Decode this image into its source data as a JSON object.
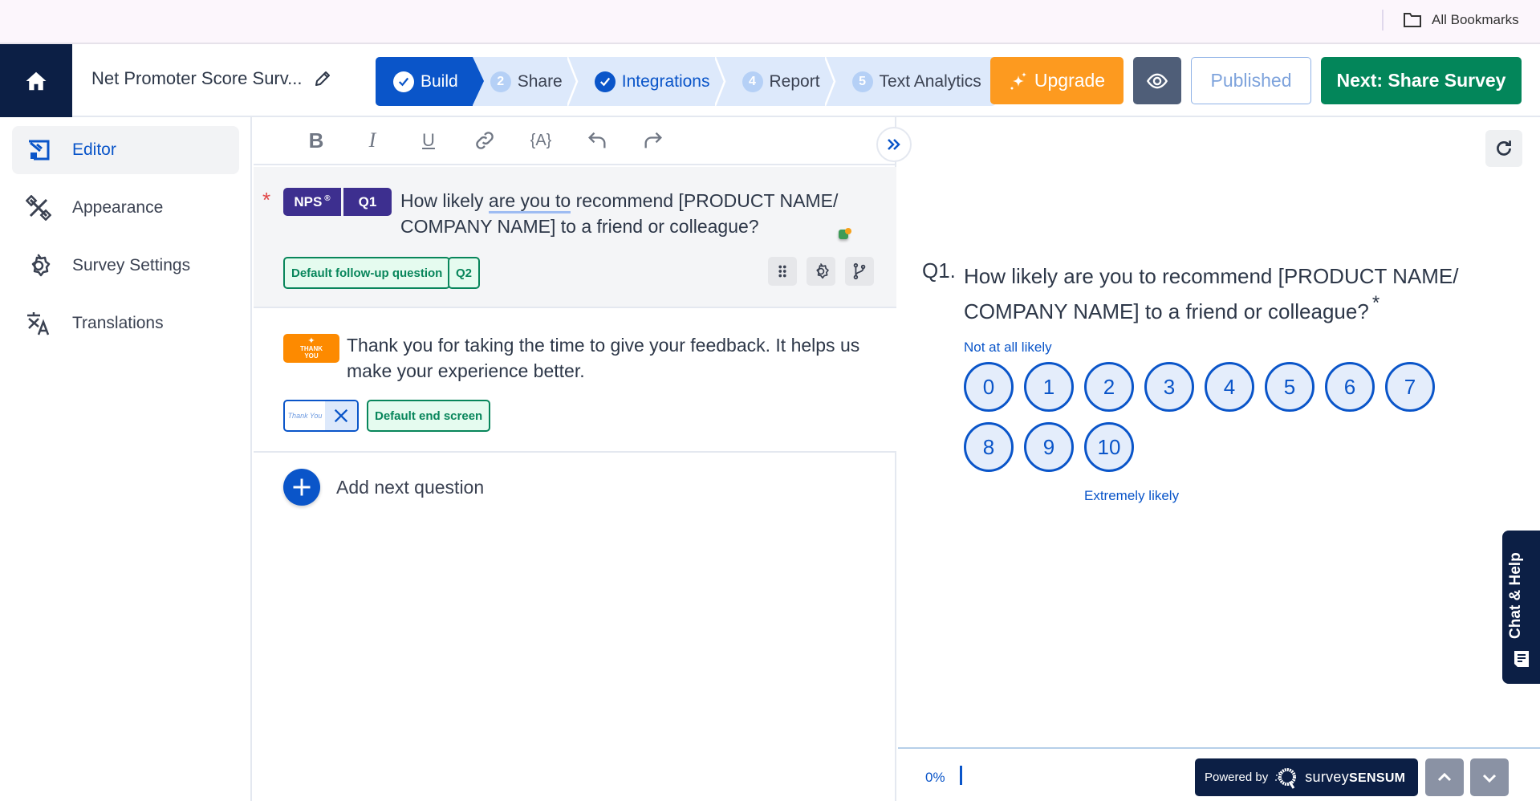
{
  "bookmarks": {
    "label": "All Bookmarks",
    "icon": "folder-icon"
  },
  "header": {
    "home_icon": "home-icon",
    "survey_title": "Net Promoter Score Surv...",
    "edit_icon": "pencil-icon",
    "steps": [
      {
        "label": "Build",
        "state": "active",
        "marker": "check"
      },
      {
        "label": "Share",
        "state": "pending",
        "marker": "2"
      },
      {
        "label": "Integrations",
        "state": "done",
        "marker": "check"
      },
      {
        "label": "Report",
        "state": "pending",
        "marker": "4"
      },
      {
        "label": "Text Analytics",
        "state": "pending",
        "marker": "5"
      }
    ],
    "upgrade_label": "Upgrade",
    "preview_icon": "eye-icon",
    "published_label": "Published",
    "next_label": "Next: Share Survey"
  },
  "sidebar": {
    "items": [
      {
        "label": "Editor",
        "icon": "editor-icon",
        "active": true
      },
      {
        "label": "Appearance",
        "icon": "appearance-icon",
        "active": false
      },
      {
        "label": "Survey Settings",
        "icon": "gear-icon",
        "active": false
      },
      {
        "label": "Translations",
        "icon": "translate-icon",
        "active": false
      }
    ]
  },
  "editor": {
    "toolbar": {
      "bold": "B",
      "italic": "I",
      "underline": "U",
      "variable": "{A}"
    },
    "question": {
      "required": "*",
      "type_badge": "NPS",
      "type_badge_sup": "®",
      "number_badge": "Q1",
      "text_before": "How likely ",
      "text_underlined": "are you to",
      "text_after": " recommend [PRODUCT NAME/ COMPANY NAME] to a friend or colleague?",
      "followup_tag": "Default follow-up question",
      "followup_target": "Q2"
    },
    "thank_you": {
      "badge_line1": "THANK",
      "badge_line2": "YOU",
      "text": "Thank you for taking the time to give your feedback. It helps us make your experience better.",
      "media_thumb": "Thank You",
      "end_screen_tag": "Default end screen"
    },
    "add_next_label": "Add next question"
  },
  "preview": {
    "question_number": "Q1.",
    "question_text": "How likely are you to recommend [PRODUCT NAME/ COMPANY NAME] to a friend or colleague?",
    "required_mark": "*",
    "low_label": "Not at all likely",
    "high_label": "Extremely likely",
    "scale": [
      "0",
      "1",
      "2",
      "3",
      "4",
      "5",
      "6",
      "7",
      "8",
      "9",
      "10"
    ],
    "progress_text": "0%",
    "progress_value": 0,
    "powered_by": "Powered by",
    "brand_light": "survey",
    "brand_bold": "SENSUM"
  },
  "chat_help_label": "Chat & Help",
  "colors": {
    "primary": "#0a55c9",
    "navy": "#0c1f45",
    "upgrade": "#fd9a1f",
    "next": "#03865a",
    "nps_badge": "#3d2f8f",
    "tag_green": "#08865b"
  }
}
